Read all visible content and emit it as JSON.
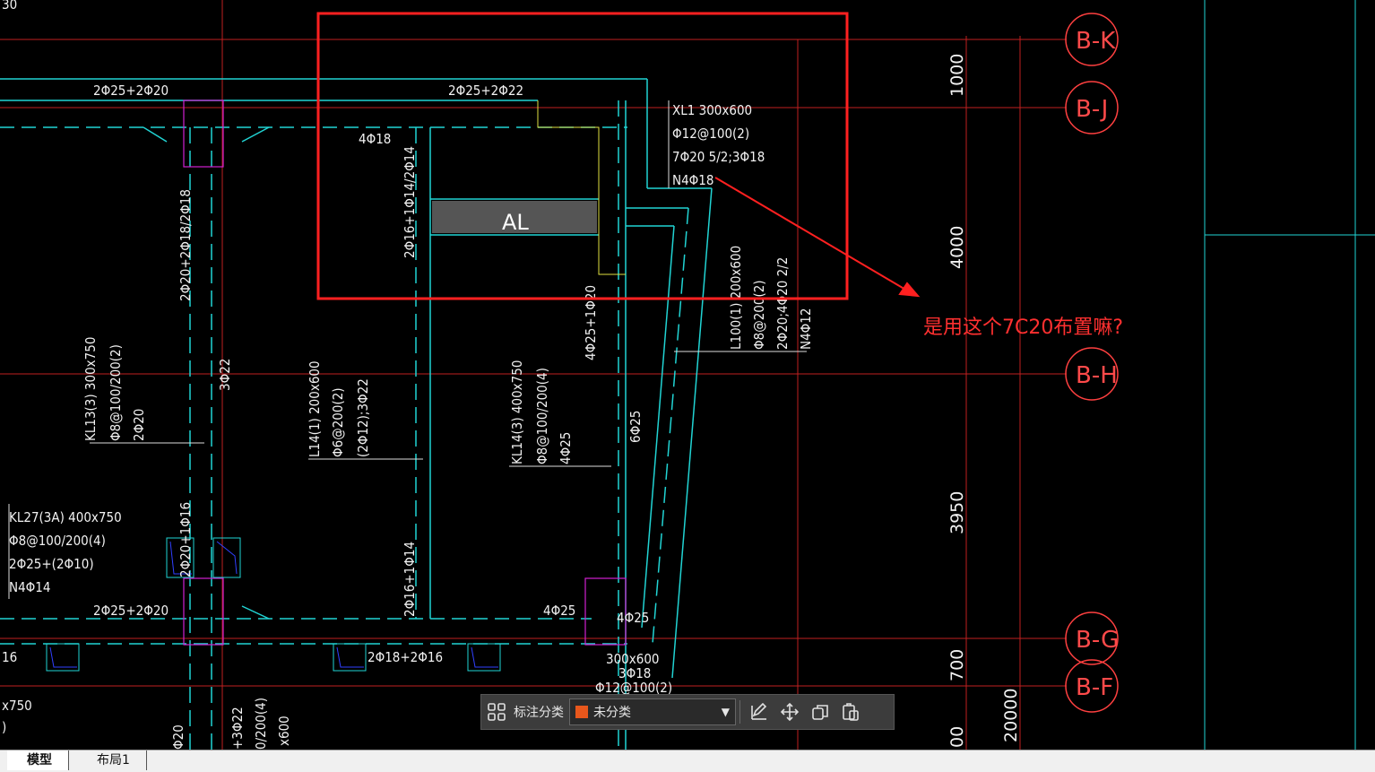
{
  "drawing": {
    "top_fragment": "30",
    "beam_labels": {
      "top_left_rebar": "2Φ25+2Φ20",
      "top_mid_rebar": "2Φ25+2Φ22",
      "rebar_4_18": "4Φ18",
      "xl1_name": "XL1 300x600",
      "xl1_stirrup": "Φ12@100(2)",
      "xl1_main": "7Φ20 5/2;3Φ18",
      "xl1_side": "N4Φ18",
      "al_label": "AL",
      "vert_2_16": "2Φ16+1Φ14/2Φ14",
      "vert_2_20": "2Φ20+2Φ18/2Φ18",
      "vert_3_22": "3Φ22",
      "vert_4_25": "4Φ25+1Φ20",
      "vert_6_25": "6Φ25",
      "kl13_name": "KL13(3) 300x750",
      "kl13_stirrup": "Φ8@100/200(2)",
      "kl13_main": "2Φ20",
      "l14_name": "L14(1) 200x600",
      "l14_stirrup": "Φ6@200(2)",
      "l14_main": "(2Φ12);3Φ22",
      "kl14_name": "KL14(3) 400x750",
      "kl14_stirrup": "Φ8@100/200(4)",
      "kl14_main": "4Φ25",
      "l100_name": "L100(1) 200x600",
      "l100_stirrup": "Φ8@200(2)",
      "l100_main": "2Φ20;4Φ20 2/2",
      "l100_side": "N4Φ12",
      "kl27_name": "KL27(3A) 400x750",
      "kl27_stirrup": "Φ8@100/200(4)",
      "kl27_main": "2Φ25+(2Φ10)",
      "kl27_side": "N4Φ14",
      "vert_2_20_16": "2Φ20+1Φ16",
      "vert_2_16_14": "2Φ16+1Φ14",
      "bottom_left_rebar": "2Φ25+2Φ20",
      "rebar_4_25_a": "4Φ25",
      "rebar_4_25_b": "4Φ25",
      "rebar_2_18_16": "2Φ18+2Φ16",
      "left_fragment_16": "16",
      "left_fragment_750": "x750",
      "left_fragment_paren": ")",
      "bottom_300x600": "300x600",
      "bottom_3_18": "3Φ18",
      "bottom_12_100": "Φ12@100(2)",
      "bottom_3_22": "+3Φ22",
      "bottom_200_4": "0/200(4)",
      "bottom_x600": "x600",
      "bottom_20": "Φ20"
    },
    "axes": [
      {
        "label": "B-K"
      },
      {
        "label": "B-J"
      },
      {
        "label": "B-H"
      },
      {
        "label": "B-G"
      },
      {
        "label": "B-F"
      }
    ],
    "dimensions": {
      "d1000": "1000",
      "d4000": "4000",
      "d3950": "3950",
      "d700": "700",
      "d20000": "20000",
      "d00": "00"
    },
    "annotation_text": "是用这个7C20布置嘛?",
    "colors": {
      "cyan": "#21d4d4",
      "red_line": "#d02020",
      "magenta": "#d020d0",
      "yellow": "#e0e040",
      "annotation_red": "#ff2020"
    }
  },
  "toolbar": {
    "label": "标注分类",
    "select_value": "未分类",
    "swatch_color": "#e8571c",
    "icons": [
      "grid-icon",
      "edit-icon",
      "move-icon",
      "copy-icon",
      "paste-icon"
    ]
  },
  "tabs": [
    {
      "label": "模型",
      "active": true
    },
    {
      "label": "布局1",
      "active": false
    }
  ]
}
